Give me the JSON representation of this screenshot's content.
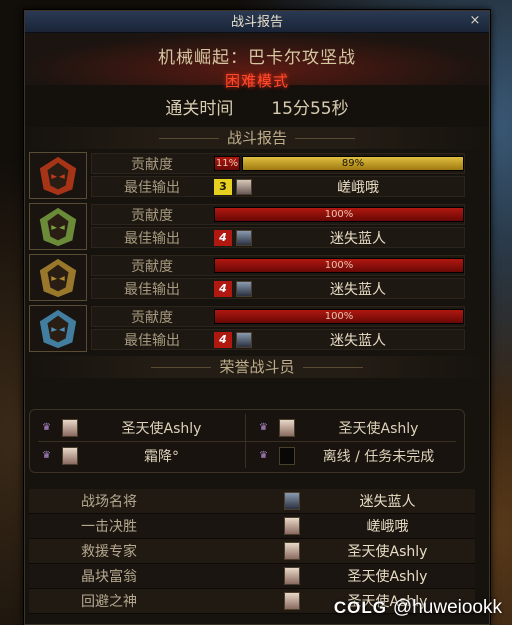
{
  "window": {
    "title": "战斗报告",
    "close_label": "×"
  },
  "header": {
    "dungeon": "机械崛起：巴卡尔攻坚战",
    "mode": "困难模式"
  },
  "clear_time": {
    "label": "通关时间",
    "value": "15分55秒"
  },
  "sections": {
    "report": "战斗报告",
    "honor": "荣誉战斗员"
  },
  "bosses": [
    {
      "portrait_icon": "red-mask-icon",
      "accent": "#c23a1a",
      "contribution_label": "贡献度",
      "best_label": "最佳输出",
      "bars": [
        {
          "pct_label": "11%",
          "value": 11,
          "style": "red"
        },
        {
          "pct_label": "89%",
          "value": 89,
          "style": "gold"
        }
      ],
      "rank_style": "gold",
      "rank": "3",
      "avatar": "light",
      "best_player": "嵯峨哦"
    },
    {
      "portrait_icon": "green-mask-icon",
      "accent": "#7aa040",
      "contribution_label": "贡献度",
      "best_label": "最佳输出",
      "bars": [
        {
          "pct_label": "100%",
          "value": 100,
          "style": "red"
        }
      ],
      "rank_style": "red",
      "rank": "4",
      "avatar": "dark",
      "best_player": "迷失蓝人"
    },
    {
      "portrait_icon": "gold-mask-icon",
      "accent": "#b08a30",
      "contribution_label": "贡献度",
      "best_label": "最佳输出",
      "bars": [
        {
          "pct_label": "100%",
          "value": 100,
          "style": "red"
        }
      ],
      "rank_style": "red",
      "rank": "4",
      "avatar": "dark",
      "best_player": "迷失蓝人"
    },
    {
      "portrait_icon": "blue-mask-icon",
      "accent": "#4a90b8",
      "contribution_label": "贡献度",
      "best_label": "最佳输出",
      "bars": [
        {
          "pct_label": "100%",
          "value": 100,
          "style": "red"
        }
      ],
      "rank_style": "red",
      "rank": "4",
      "avatar": "dark",
      "best_player": "迷失蓝人"
    }
  ],
  "honor": [
    {
      "name": "圣天使Ashly",
      "empty": false
    },
    {
      "name": "圣天使Ashly",
      "empty": false
    },
    {
      "name": "霜降°",
      "empty": false
    },
    {
      "name": "离线 / 任务未完成",
      "empty": true
    }
  ],
  "awards": [
    {
      "title": "战场名将",
      "player": "迷失蓝人",
      "avatar": "dark"
    },
    {
      "title": "一击决胜",
      "player": "嵯峨哦",
      "avatar": "light"
    },
    {
      "title": "救援专家",
      "player": "圣天使Ashly",
      "avatar": "light"
    },
    {
      "title": "晶块富翁",
      "player": "圣天使Ashly",
      "avatar": "light"
    },
    {
      "title": "回避之神",
      "player": "圣天使Ashly",
      "avatar": "light"
    }
  ],
  "watermark": {
    "logo": "COLG",
    "user": "@huweiookk"
  }
}
